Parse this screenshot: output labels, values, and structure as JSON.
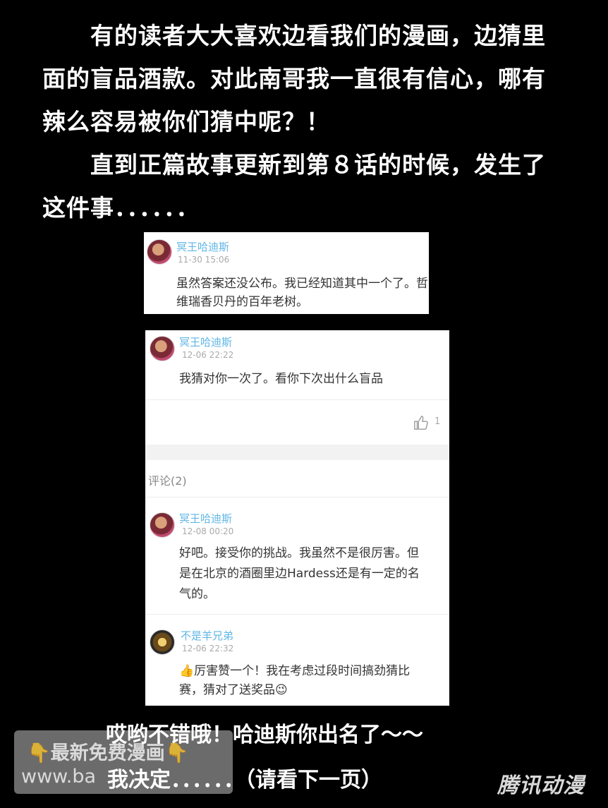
{
  "intro": {
    "para1": "　　有的读者大大喜欢边看我们的漫画，边猜里面的盲品酒款。对此南哥我一直很有信心，哪有辣么容易被你们猜中呢？！",
    "para2": "　　直到正篇故事更新到第８话的时候，发生了这件事．．．．．．"
  },
  "card1": {
    "username": "冥王哈迪斯",
    "time": "11-30 15:06",
    "text": "虽然答案还没公布。我已经知道其中一个了。哲维瑞香贝丹的百年老树。"
  },
  "card2": {
    "post": {
      "username": "冥王哈迪斯",
      "time": "12-06 22:22",
      "text": "我猜对你一次了。看你下次出什么盲品",
      "likes": "1",
      "like_icon": "thumbs-up-icon"
    },
    "comments_header": "评论(2)",
    "comments": [
      {
        "username": "冥王哈迪斯",
        "time": "12-08 00:20",
        "text": "好吧。接受你的挑战。我虽然不是很厉害。但是在北京的酒圈里边Hardess还是有一定的名气的。"
      },
      {
        "username": "不是羊兄弟",
        "time": "12-06 22:32",
        "emoji_start": "👍",
        "text": "厉害赞一个！我在考虑过段时间搞劲猜比赛，猜对了送奖品",
        "emoji_end": "😉"
      }
    ]
  },
  "footer": {
    "line1": "哎哟不错哦！哈迪斯你出名了～～",
    "line2": "我决定．．．．．．（请看下一页）"
  },
  "watermark": {
    "line1_emoji": "👇",
    "line1": "最新免费漫画",
    "line1_emoji_end": "👇",
    "line2": "www.ba"
  },
  "logo": "腾讯动漫"
}
